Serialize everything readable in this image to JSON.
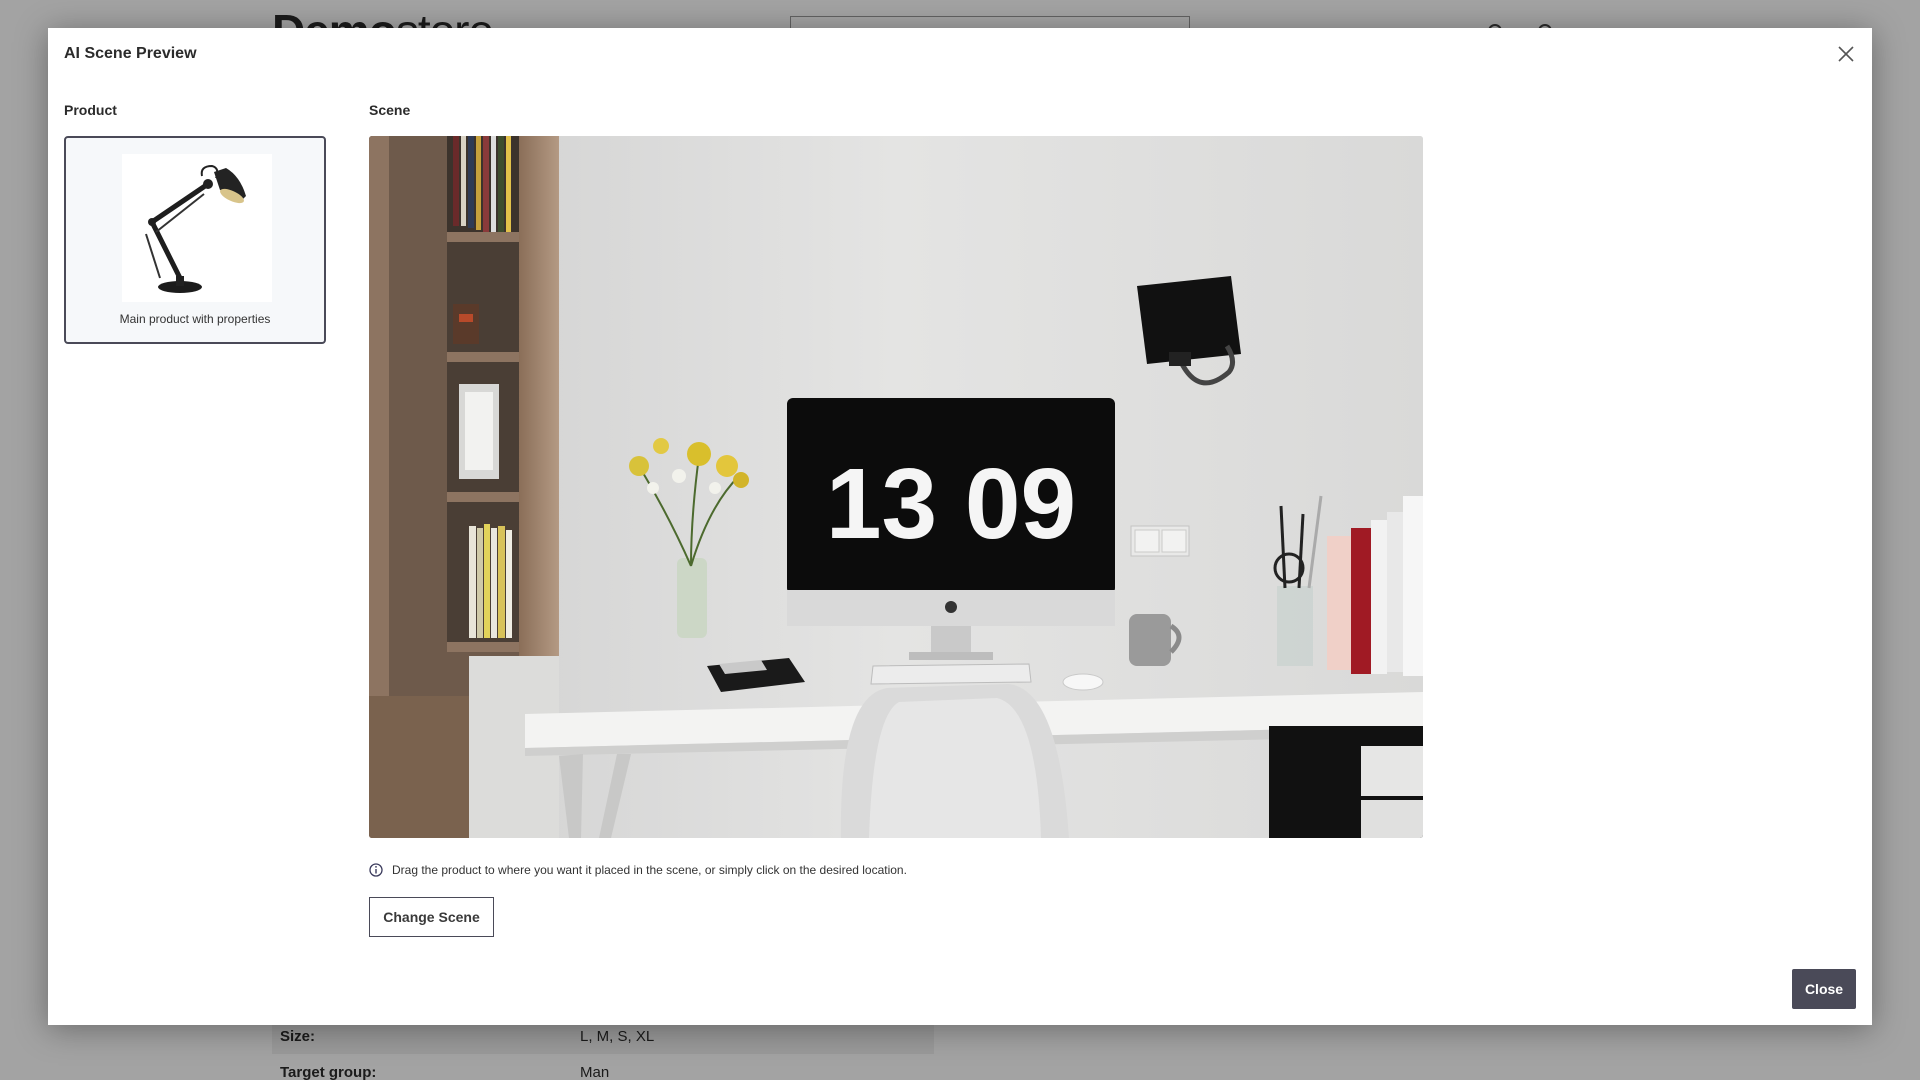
{
  "store": {
    "logo_bold": "Demo",
    "logo_light": "store",
    "properties": [
      {
        "key": "Size:",
        "value": "L, M, S, XL"
      },
      {
        "key": "Target group:",
        "value": "Man"
      }
    ]
  },
  "modal": {
    "title": "AI Scene Preview",
    "close_icon": "close-icon",
    "product_label": "Product",
    "scene_label": "Scene",
    "product_caption": "Main product with properties",
    "product_image": "desk-lamp",
    "scene_image": "home-office-desk",
    "scene_clock": "13 09",
    "hint_icon": "info-circle-icon",
    "hint_text": "Drag the product to where you want it placed in the scene, or simply click on the desired location.",
    "change_scene_label": "Change Scene",
    "close_label": "Close"
  },
  "colors": {
    "accent": "#4a4a58",
    "overlay": "rgba(0,0,0,0.36)",
    "card_bg": "#f6f8fa"
  }
}
